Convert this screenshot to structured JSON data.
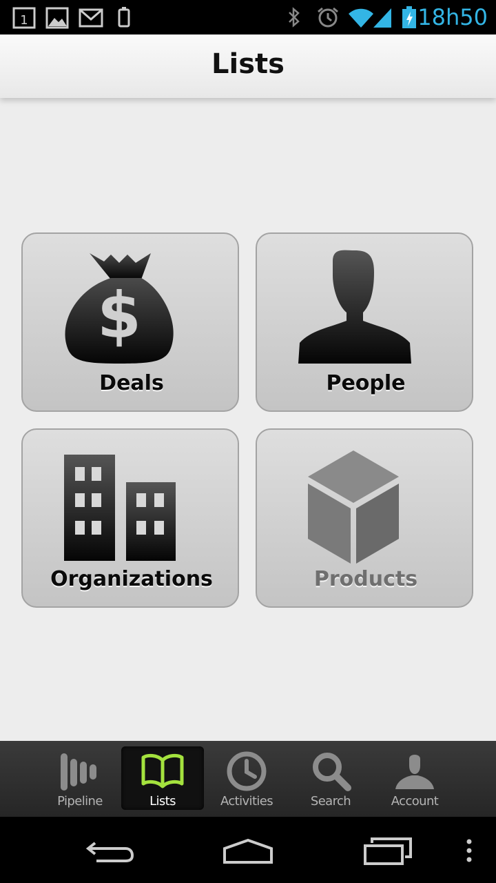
{
  "status_bar": {
    "time": "18h50",
    "left_icons": [
      "calendar-icon",
      "gallery-icon",
      "gmail-icon",
      "phone-icon"
    ],
    "right_icons": [
      "bluetooth-icon",
      "alarm-icon",
      "wifi-icon",
      "signal-icon",
      "battery-charging-icon"
    ],
    "accent_color": "#33b5e5"
  },
  "header": {
    "title": "Lists"
  },
  "tiles": [
    {
      "label": "Deals",
      "icon": "money-bag-icon",
      "enabled": true
    },
    {
      "label": "People",
      "icon": "person-icon",
      "enabled": true
    },
    {
      "label": "Organizations",
      "icon": "buildings-icon",
      "enabled": true
    },
    {
      "label": "Products",
      "icon": "box-icon",
      "enabled": false
    }
  ],
  "bottom_nav": {
    "active": "Lists",
    "active_color": "#a4e23e",
    "items": [
      {
        "label": "Pipeline",
        "icon": "pipeline-icon"
      },
      {
        "label": "Lists",
        "icon": "book-icon"
      },
      {
        "label": "Activities",
        "icon": "clock-icon"
      },
      {
        "label": "Search",
        "icon": "search-icon"
      },
      {
        "label": "Account",
        "icon": "account-icon"
      }
    ]
  },
  "system_nav": {
    "buttons": [
      "back-icon",
      "home-icon",
      "recent-apps-icon",
      "menu-icon"
    ]
  }
}
